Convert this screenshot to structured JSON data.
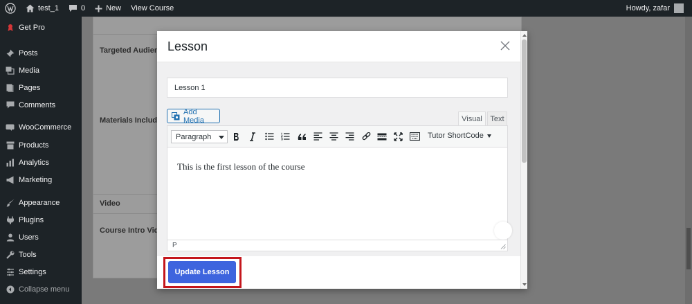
{
  "admin_bar": {
    "site_name": "test_1",
    "comments_count": "0",
    "new_label": "New",
    "view_course_label": "View Course",
    "greeting": "Howdy, zafar"
  },
  "sidebar": {
    "items": [
      {
        "label": "Get Pro",
        "icon": "get-pro-icon"
      },
      {
        "label": "Posts",
        "icon": "pin-icon"
      },
      {
        "label": "Media",
        "icon": "media-icon"
      },
      {
        "label": "Pages",
        "icon": "pages-icon"
      },
      {
        "label": "Comments",
        "icon": "comment-icon"
      },
      {
        "label": "WooCommerce",
        "icon": "woocommerce-icon"
      },
      {
        "label": "Products",
        "icon": "archive-icon"
      },
      {
        "label": "Analytics",
        "icon": "chart-bar-icon"
      },
      {
        "label": "Marketing",
        "icon": "megaphone-icon"
      },
      {
        "label": "Appearance",
        "icon": "brush-icon"
      },
      {
        "label": "Plugins",
        "icon": "plugin-icon"
      },
      {
        "label": "Users",
        "icon": "users-icon"
      },
      {
        "label": "Tools",
        "icon": "wrench-icon"
      },
      {
        "label": "Settings",
        "icon": "settings-icon"
      },
      {
        "label": "Collapse menu",
        "icon": "collapse-icon"
      }
    ]
  },
  "background_form": {
    "labels": [
      "Targeted Audience",
      "Materials Included",
      "Video",
      "Course Intro Video"
    ]
  },
  "modal": {
    "title": "Lesson",
    "lesson_title_value": "Lesson 1",
    "add_media_label": "Add Media",
    "tab_visual": "Visual",
    "tab_text": "Text",
    "format_select_value": "Paragraph",
    "shortcode_label": "Tutor ShortCode",
    "content_text": "This is the first lesson of the course",
    "status_path": "P",
    "update_button_label": "Update Lesson"
  },
  "colors": {
    "admin_dark": "#1d2327",
    "primary_button": "#3e64de",
    "highlight_border": "#c4161c",
    "link_blue": "#2271b1"
  }
}
